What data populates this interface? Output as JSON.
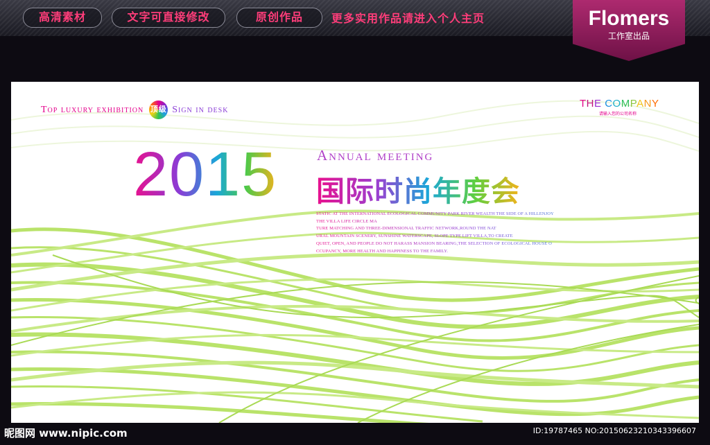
{
  "header": {
    "pills": [
      "高清素材",
      "文字可直接修改",
      "原创作品"
    ],
    "promo": "更多实用作品请进入个人主页",
    "brand_name": "Flomers",
    "brand_sub": "工作室出品"
  },
  "poster": {
    "tagline_left": "Top luxury exhibition",
    "badge_text": "顶级",
    "tagline_right": "Sign in desk",
    "company": "THE COMPANY",
    "company_sub": "请输入您的公司名称",
    "year": "2015",
    "annual": "Annual meeting",
    "title_cn": "国际时尚年度会",
    "description": [
      "STATIC AT THE INTERNATIONAL ECOLOGICAL COMMUNITY PARK RIVER WEALTH THE SIDE OF A HILLENJOY",
      "THE VILLA LIFE CIRCLE MA",
      "TURE MATCHING AND THREE-DIMENSIONAL TRAFFIC NETWORK,ROUND THE NAT",
      "URAL MOUNTAIN SCENERY, SUNSHINE WATERSCAPE, SLOPE TYPE LIFT VILLA,TO CREATE",
      "QUIET, OPEN, AND PEOPLE DO NOT HARASS MANSION BEARING,THE SELECTION OF ECOLOGICAL HOUSE O",
      "CCUPANCY, MORE HEALTH AND HAPPINESS TO THE FAMILY."
    ],
    "company_colors": [
      "#e4008b",
      "#c0147a",
      "#9b2bd0",
      "#5f47d8",
      "#1a8fe0",
      "#1fb0c8",
      "#2fbf5a",
      "#8cc63f",
      "#f0c419",
      "#f49a1b",
      "#ff6a00"
    ]
  },
  "footer": {
    "logo": "昵图网 www.nipic.com",
    "id": "ID:19787465 NO:20150623210343396607"
  },
  "colors": {
    "accent_pink": "#ff3d7a",
    "brand_magenta": "#ad2a6f",
    "wave_green": "#b9e36a"
  }
}
